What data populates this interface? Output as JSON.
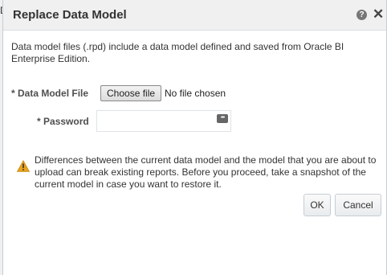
{
  "background_char": "D",
  "dialog": {
    "title": "Replace Data Model",
    "help_glyph": "?",
    "close_glyph": "✕",
    "intro": "Data model files (.rpd) include a data model defined and saved from Oracle BI Enterprise Edition.",
    "required_marker": "*",
    "file_field": {
      "label": "Data Model File",
      "button_label": "Choose file",
      "status": "No file chosen"
    },
    "password_field": {
      "label": "Password",
      "value": ""
    },
    "warning": {
      "icon": "warning-triangle-icon",
      "text": "Differences between the current data model and the model that you are about to upload can break existing reports. Before you proceed, take a snapshot of the current model in case you want to restore it."
    },
    "buttons": {
      "ok": "OK",
      "cancel": "Cancel"
    }
  },
  "colors": {
    "titlebar_bg": "#f0f0f0",
    "warning": "#e8a31d",
    "text": "#333333"
  }
}
